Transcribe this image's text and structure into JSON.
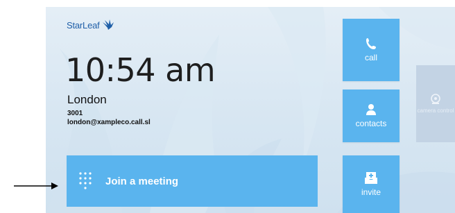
{
  "brand": {
    "name": "StarLeaf",
    "logo_icon": "starleaf-bird-icon",
    "color": "#1f5fa8"
  },
  "status": {
    "time": "10:54 am",
    "location": "London",
    "extension": "3001",
    "address": "london@xampleco.call.sl"
  },
  "tiles": {
    "call": {
      "label": "call",
      "icon": "phone-icon"
    },
    "contacts": {
      "label": "contacts",
      "icon": "person-icon"
    },
    "invite": {
      "label": "invite",
      "icon": "inbox-plus-icon"
    },
    "camera": {
      "label": "camera control",
      "icon": "camera-icon"
    }
  },
  "join": {
    "label": "Join a meeting",
    "icon": "dialpad-icon"
  },
  "colors": {
    "tile": "#5ab4ee",
    "tile_disabled": "#c3d3e4",
    "background": "#d7e6f2"
  }
}
